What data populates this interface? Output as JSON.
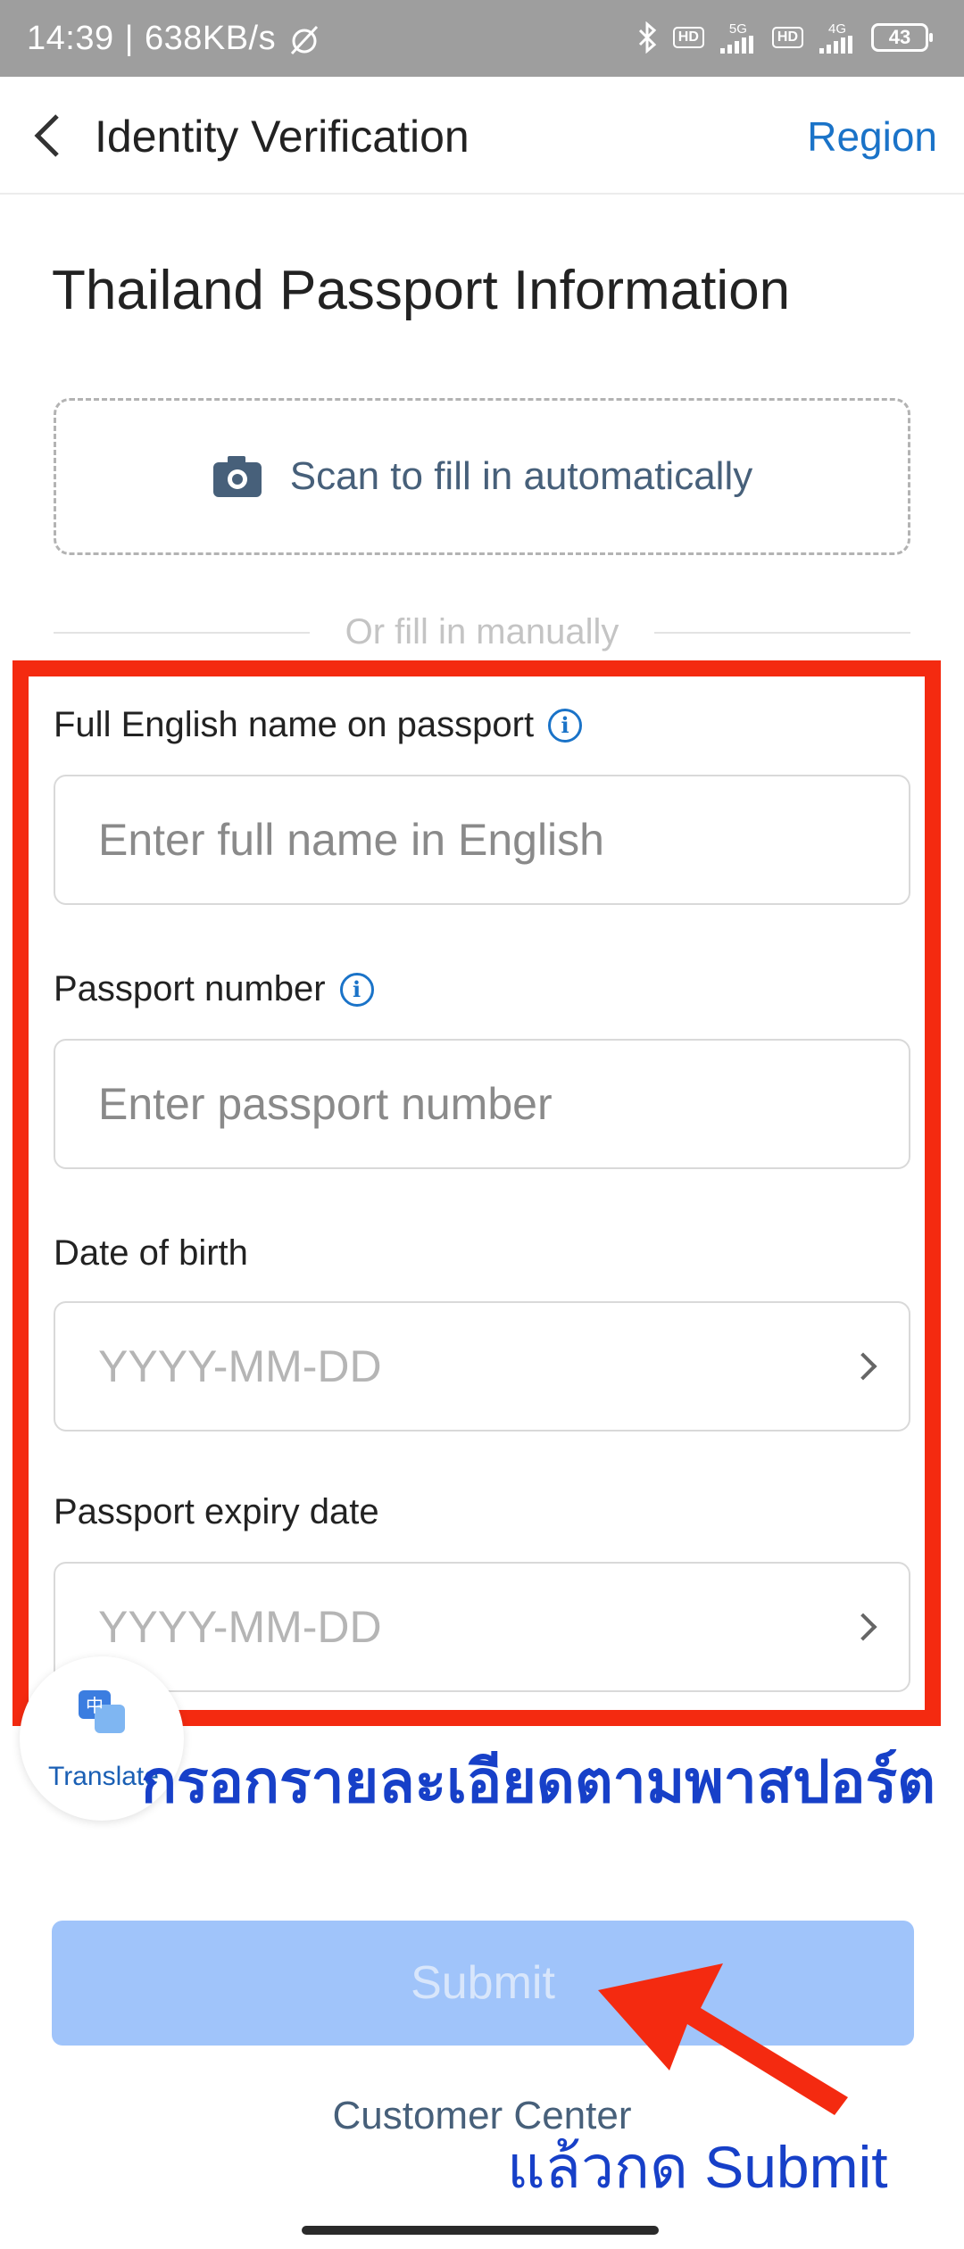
{
  "status_bar": {
    "time": "14:39",
    "separator": "|",
    "speed": "638KB/s",
    "hd1": "HD",
    "net1": "5G",
    "hd2": "HD",
    "net2": "4G",
    "battery": "43"
  },
  "header": {
    "title": "Identity Verification",
    "region_label": "Region"
  },
  "page_title": "Thailand Passport Information",
  "scan": {
    "label": "Scan to fill in automatically"
  },
  "divider_text": "Or fill in manually",
  "form": {
    "name_label": "Full English name on passport",
    "name_placeholder": "Enter full name in English",
    "passport_label": "Passport number",
    "passport_placeholder": "Enter passport number",
    "dob_label": "Date of birth",
    "dob_placeholder": "YYYY-MM-DD",
    "expiry_label": "Passport expiry date",
    "expiry_placeholder": "YYYY-MM-DD"
  },
  "translate": {
    "label": "Translate",
    "glyph": "中"
  },
  "annotation": {
    "thai_instruction": "กรอกรายละเอียดตามพาสปอร์ต",
    "submit_instruction": "แล้วกด Submit"
  },
  "submit_label": "Submit",
  "customer_center": "Customer Center",
  "colors": {
    "accent": "#1a73c8",
    "annotation_red": "#f42a10",
    "annotation_blue": "#1740c8",
    "submit_disabled": "#a0c4fa"
  }
}
